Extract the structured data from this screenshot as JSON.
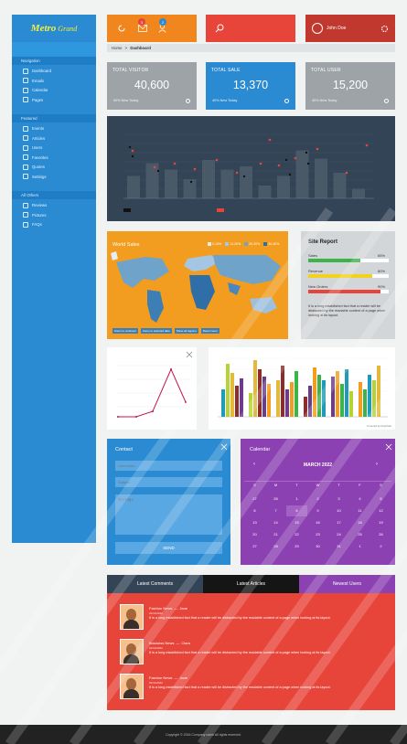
{
  "brand": {
    "name": "Metro",
    "suffix": "Grand"
  },
  "sidebar": {
    "sections": [
      {
        "title": "Navigation",
        "items": [
          "Dashboard",
          "Emails",
          "Calendar",
          "Pages"
        ]
      },
      {
        "title": "Featured",
        "items": [
          "Events",
          "Articles",
          "Users",
          "Favorites",
          "Quotes",
          "Settings"
        ]
      },
      {
        "title": "All Others",
        "items": [
          "Reviews",
          "Pictures",
          "FAQs"
        ]
      }
    ]
  },
  "header": {
    "badge_mail": "3",
    "badge_user": "2",
    "user_name": "John Doe"
  },
  "breadcrumb": {
    "home": "Home",
    "current": "Dashboard"
  },
  "stats": [
    {
      "label": "TOTAL VISITOR",
      "value": "40,600",
      "sub": "50% New Today",
      "color": "#9ea3a7"
    },
    {
      "label": "TOTAL SALE",
      "value": "13,370",
      "sub": "40% New Today",
      "color": "#2a8bd2"
    },
    {
      "label": "TOTAL USER",
      "value": "15,200",
      "sub": "40% New Today",
      "color": "#9ea3a7"
    }
  ],
  "main_chart": {
    "colors": {
      "bar": "#4a5968",
      "dot": "#e8453a",
      "marker": "#111111"
    }
  },
  "world": {
    "title": "World Sales",
    "legend": [
      "0-10%",
      "10-20%",
      "20-30%",
      "30-40%"
    ],
    "buttons": [
      "Zoom to continent",
      "Zoom to selected data",
      "Show all regions",
      "Reset zoom"
    ]
  },
  "report": {
    "title": "Site Report",
    "bars": [
      {
        "label": "Sales",
        "value": "65%",
        "pct": 0.65,
        "color": "#3cb44b"
      },
      {
        "label": "Revenue",
        "value": "80%",
        "pct": 0.8,
        "color": "#f2d21b"
      },
      {
        "label": "New Orders",
        "value": "90%",
        "pct": 0.9,
        "color": "#e8453a"
      }
    ],
    "note": "It is a long established fact that a reader will be distracted by the readable content of a page when looking at its layout."
  },
  "bar_chart": {
    "credit": "Powered by AnyChart"
  },
  "contact": {
    "title": "Contact",
    "placeholders": [
      "Username",
      "Subject",
      "Message"
    ],
    "send": "SEND"
  },
  "calendar": {
    "title": "Calendar",
    "month": "MARCH 2022",
    "weekdays": [
      "S",
      "M",
      "T",
      "W",
      "T",
      "F",
      "S"
    ],
    "rows": [
      [
        "27",
        "28",
        "1",
        "2",
        "3",
        "4",
        "5"
      ],
      [
        "6",
        "7",
        "8",
        "9",
        "10",
        "11",
        "12"
      ],
      [
        "13",
        "14",
        "15",
        "16",
        "17",
        "18",
        "19"
      ],
      [
        "20",
        "21",
        "22",
        "23",
        "24",
        "25",
        "26"
      ],
      [
        "27",
        "28",
        "29",
        "30",
        "31",
        "1",
        "2"
      ]
    ]
  },
  "tabs": [
    {
      "label": "Latest Comments",
      "color": "#334456"
    },
    {
      "label": "Latest Articles",
      "color": "#151515"
    },
    {
      "label": "Newest Users",
      "color": "#8c41b3"
    }
  ],
  "comments": [
    {
      "title": "Fashion News",
      "author": "Jane",
      "date": "01/11/2022",
      "text": "It is a long established fact that a reader will be distracted by the readable content of a page when looking at its layout."
    },
    {
      "title": "Business News",
      "author": "Clara",
      "date": "01/11/2022",
      "text": "It is a long established fact that a reader will be distracted by the readable content of a page when looking at its layout."
    },
    {
      "title": "Fashion News",
      "author": "Jane",
      "date": "01/11/2022",
      "text": "It is a long established fact that a reader will be distracted by the readable content of a page when looking at its layout."
    }
  ],
  "footer": "Copyright © 2016 Company name All rights reserved."
}
